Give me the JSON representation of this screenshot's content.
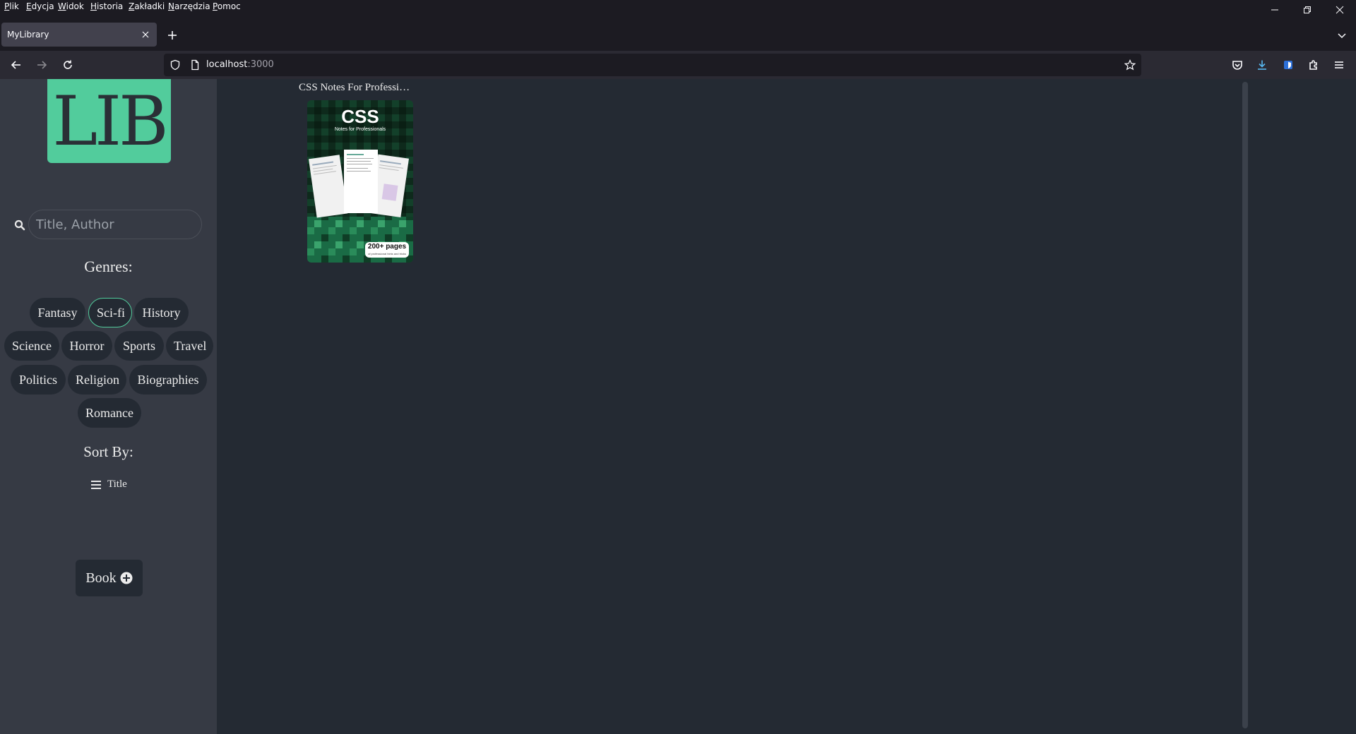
{
  "menubar": {
    "items": [
      {
        "u": "P",
        "rest": "lik"
      },
      {
        "u": "E",
        "rest": "dycja"
      },
      {
        "u": "W",
        "rest": "idok"
      },
      {
        "u": "H",
        "rest": "istoria"
      },
      {
        "u": "Z",
        "rest": "akładki"
      },
      {
        "u": "N",
        "rest": "arzędzia"
      },
      {
        "u": "P",
        "rest": "omoc"
      }
    ]
  },
  "tab": {
    "title": "MyLibrary"
  },
  "urlbar": {
    "host": "localhost",
    "port": ":3000"
  },
  "sidebar": {
    "logo": "LIB",
    "search_placeholder": "Title, Author",
    "genres_title": "Genres:",
    "genres": [
      "Fantasy",
      "Sci-fi",
      "History",
      "Science",
      "Horror",
      "Sports",
      "Travel",
      "Politics",
      "Religion",
      "Biographies",
      "Romance"
    ],
    "active_genre": "Sci-fi",
    "sort_title": "Sort By:",
    "sort_option": "Title",
    "add_book_label": "Book"
  },
  "books": [
    {
      "title": "CSS Notes For Professi…",
      "cover_title": "CSS",
      "cover_subtitle": "Notes for Professionals",
      "cover_badge": "200+ pages",
      "cover_badge_sub": "of professional hints and tricks"
    }
  ],
  "colors": {
    "accent": "#52cc9c",
    "sidebar_bg": "#363a44",
    "content_bg": "#242a33",
    "pill_bg": "#242a33"
  }
}
